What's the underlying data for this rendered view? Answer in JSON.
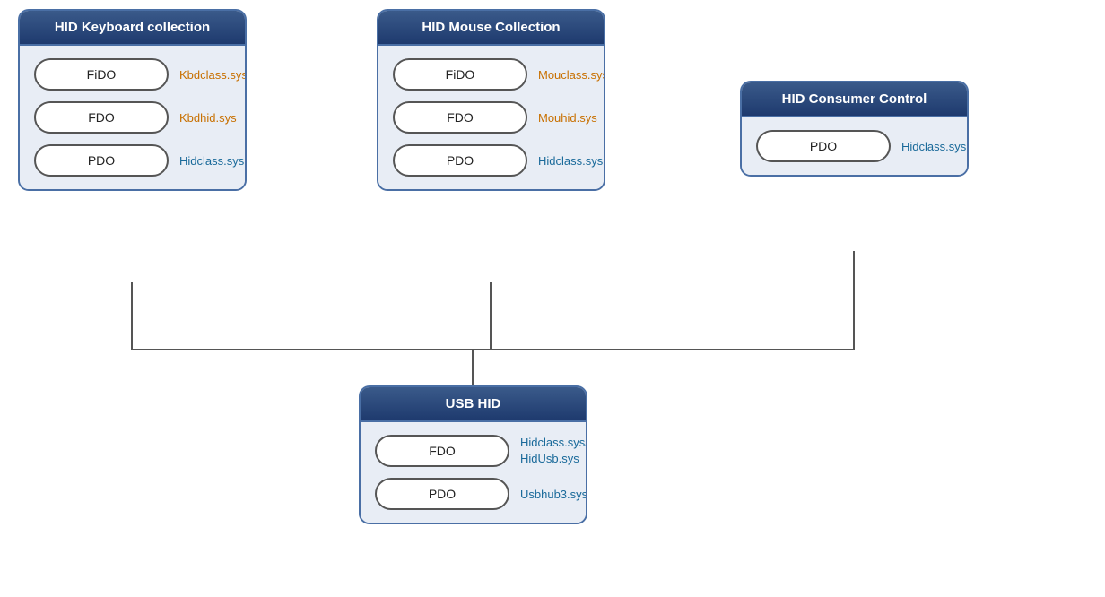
{
  "boxes": {
    "keyboard": {
      "title": "HID Keyboard collection",
      "nodes": [
        {
          "label": "FiDO",
          "sys": "Kbdclass.sys",
          "sys_color": "orange"
        },
        {
          "label": "FDO",
          "sys": "Kbdhid.sys",
          "sys_color": "orange"
        },
        {
          "label": "PDO",
          "sys": "Hidclass.sys",
          "sys_color": "blue"
        }
      ]
    },
    "mouse": {
      "title": "HID Mouse Collection",
      "nodes": [
        {
          "label": "FiDO",
          "sys": "Mouclass.sys",
          "sys_color": "orange"
        },
        {
          "label": "FDO",
          "sys": "Mouhid.sys",
          "sys_color": "orange"
        },
        {
          "label": "PDO",
          "sys": "Hidclass.sys",
          "sys_color": "blue"
        }
      ]
    },
    "consumer": {
      "title": "HID Consumer Control",
      "nodes": [
        {
          "label": "PDO",
          "sys": "Hidclass.sys",
          "sys_color": "blue"
        }
      ]
    },
    "usb": {
      "title": "USB HID",
      "nodes": [
        {
          "label": "FDO",
          "sys": "Hidclass.sys/\nHidUsb.sys",
          "sys_color": "blue"
        },
        {
          "label": "PDO",
          "sys": "Usbhub3.sys",
          "sys_color": "blue"
        }
      ]
    }
  }
}
